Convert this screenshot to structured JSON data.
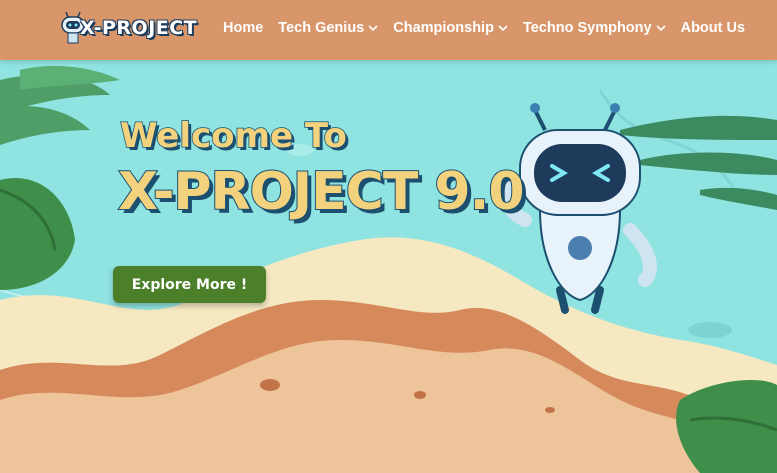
{
  "brand": {
    "name": "X-PROJECT"
  },
  "nav": {
    "items": [
      {
        "label": "Home"
      },
      {
        "label": "Tech Genius"
      },
      {
        "label": "Championship"
      },
      {
        "label": "Techno Symphony"
      },
      {
        "label": "About Us"
      }
    ]
  },
  "hero": {
    "welcome": "Welcome To",
    "title": "X-PROJECT 9.0",
    "cta_label": "Explore More !"
  },
  "colors": {
    "navbar": "#d8966a",
    "sea": "#8fe3e0",
    "sand": "#f6e9c2",
    "cliff": "#d68a5c",
    "title_fill": "#f3d27d",
    "title_outline": "#1c4f70",
    "button": "#4c7f2a"
  },
  "icons": [
    "robot-logo-icon",
    "chevron-down-icon",
    "robot-mascot"
  ]
}
